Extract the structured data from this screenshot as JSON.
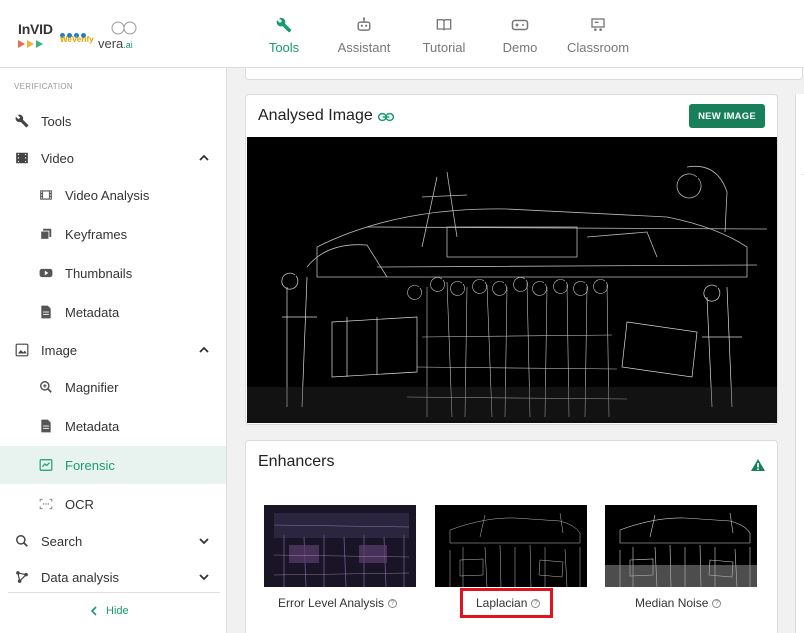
{
  "header": {
    "logo": {
      "invid": "InVID",
      "weverify": "WeVerify",
      "vera": "vera",
      "vera_suffix": ".ai"
    },
    "tabs": [
      {
        "label": "Tools",
        "icon": "wrench-icon",
        "active": true
      },
      {
        "label": "Assistant",
        "icon": "robot-icon",
        "active": false
      },
      {
        "label": "Tutorial",
        "icon": "book-icon",
        "active": false
      },
      {
        "label": "Demo",
        "icon": "gamepad-icon",
        "active": false
      },
      {
        "label": "Classroom",
        "icon": "classroom-icon",
        "active": false
      }
    ]
  },
  "sidebar": {
    "section_label": "VERIFICATION",
    "items": [
      {
        "label": "Tools",
        "icon": "wrench-icon"
      },
      {
        "label": "Video",
        "icon": "film-icon",
        "expanded": true
      },
      {
        "label": "Video Analysis",
        "icon": "film-strip-icon"
      },
      {
        "label": "Keyframes",
        "icon": "layers-icon"
      },
      {
        "label": "Thumbnails",
        "icon": "youtube-icon"
      },
      {
        "label": "Metadata",
        "icon": "document-icon"
      },
      {
        "label": "Image",
        "icon": "image-icon",
        "expanded": true
      },
      {
        "label": "Magnifier",
        "icon": "magnifier-icon"
      },
      {
        "label": "Metadata",
        "icon": "document-icon"
      },
      {
        "label": "Forensic",
        "icon": "forensic-icon",
        "active": true
      },
      {
        "label": "OCR",
        "icon": "ocr-icon"
      },
      {
        "label": "Search",
        "icon": "search-icon",
        "expanded": false
      },
      {
        "label": "Data analysis",
        "icon": "data-analysis-icon",
        "expanded": false
      }
    ],
    "hide_label": "Hide"
  },
  "analysed": {
    "title": "Analysed Image",
    "new_image_label": "NEW IMAGE"
  },
  "enhancers": {
    "title": "Enhancers",
    "items": [
      {
        "label": "Error Level Analysis"
      },
      {
        "label": "Laplacian",
        "highlighted": true
      },
      {
        "label": "Median Noise"
      }
    ]
  },
  "colors": {
    "accent": "#1a9b6c",
    "button": "#17805a",
    "highlight_box": "#e0141e"
  }
}
